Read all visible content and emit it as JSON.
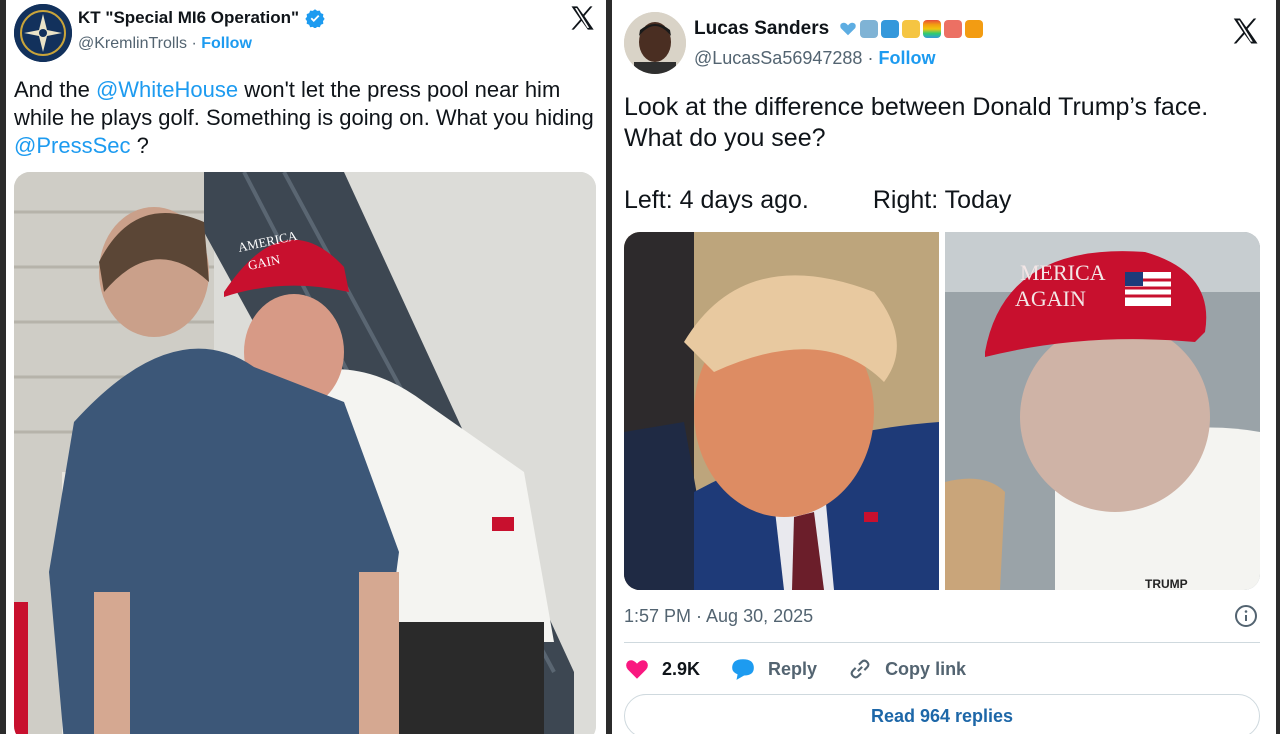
{
  "left_tweet": {
    "display_name": "KT \"Special MI6 Operation\"",
    "handle": "@KremlinTrolls",
    "separator": "·",
    "follow_label": "Follow",
    "text": {
      "part1": "And the ",
      "mention1": "@WhiteHouse",
      "part2": "  won't let the press pool near him while he plays golf. Something is going on. What you hiding ",
      "mention2": "@PressSec",
      "part3": " ?"
    },
    "image": {
      "hat_text_line1": "AMERICA",
      "hat_text_line2": "GAIN"
    }
  },
  "right_tweet": {
    "display_name": "Lucas Sanders",
    "handle": "@LucasSa56947288",
    "separator": "·",
    "follow_label": "Follow",
    "text": "Look at the difference between Donald Trump’s face. What do you see?",
    "caption_left": "Left: 4 days ago.",
    "caption_right": "Right: Today",
    "image_right": {
      "hat_text_line1": "MERICA",
      "hat_text_line2": "AGAIN",
      "shirt_text": "TRUMP"
    },
    "timestamp": "1:57 PM · Aug 30, 2025",
    "likes_count": "2.9K",
    "reply_label": "Reply",
    "copy_link_label": "Copy link",
    "read_replies_label": "Read 964 replies"
  },
  "colors": {
    "link_blue": "#1d9bf0",
    "heart_pink": "#f91880",
    "hat_red": "#c8102e",
    "text_dark": "#0f1419",
    "text_gray": "#536471"
  },
  "icons": [
    "verified-badge-icon",
    "x-logo-icon",
    "heart-icon",
    "reply-bubble-icon",
    "link-icon",
    "info-icon"
  ]
}
